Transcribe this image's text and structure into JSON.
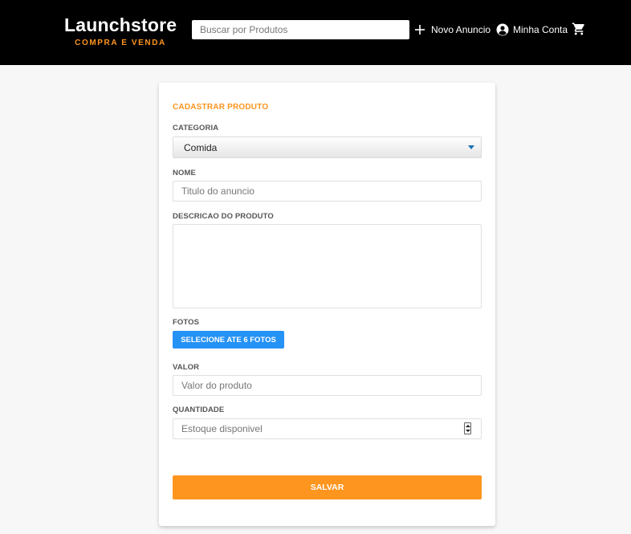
{
  "header": {
    "logo_title": "Launchstore",
    "logo_subtitle": "COMPRA E VENDA",
    "search_placeholder": "Buscar por Produtos",
    "new_ad_label": "Novo Anuncio",
    "account_label": "Minha Conta",
    "icons": {
      "new_ad": "plus-icon",
      "account": "account-circle-icon",
      "cart": "shopping-cart-icon"
    }
  },
  "form": {
    "title": "CADASTRAR PRODUTO",
    "category_label": "CATEGORIA",
    "category_value": "Comida",
    "name_label": "NOME",
    "name_placeholder": "Titulo do anuncio",
    "description_label": "DESCRICAO DO PRODUTO",
    "photos_label": "FOTOS",
    "photos_button": "SELECIONE ATE 6 FOTOS",
    "price_label": "VALOR",
    "price_placeholder": "Valor do produto",
    "quantity_label": "QUANTIDADE",
    "quantity_placeholder": "Estoque disponivel",
    "save_button": "SALVAR"
  },
  "colors": {
    "header_bg": "#000000",
    "accent": "#fd951f",
    "button_blue": "#2592f5",
    "page_bg": "#f7f7f7"
  }
}
